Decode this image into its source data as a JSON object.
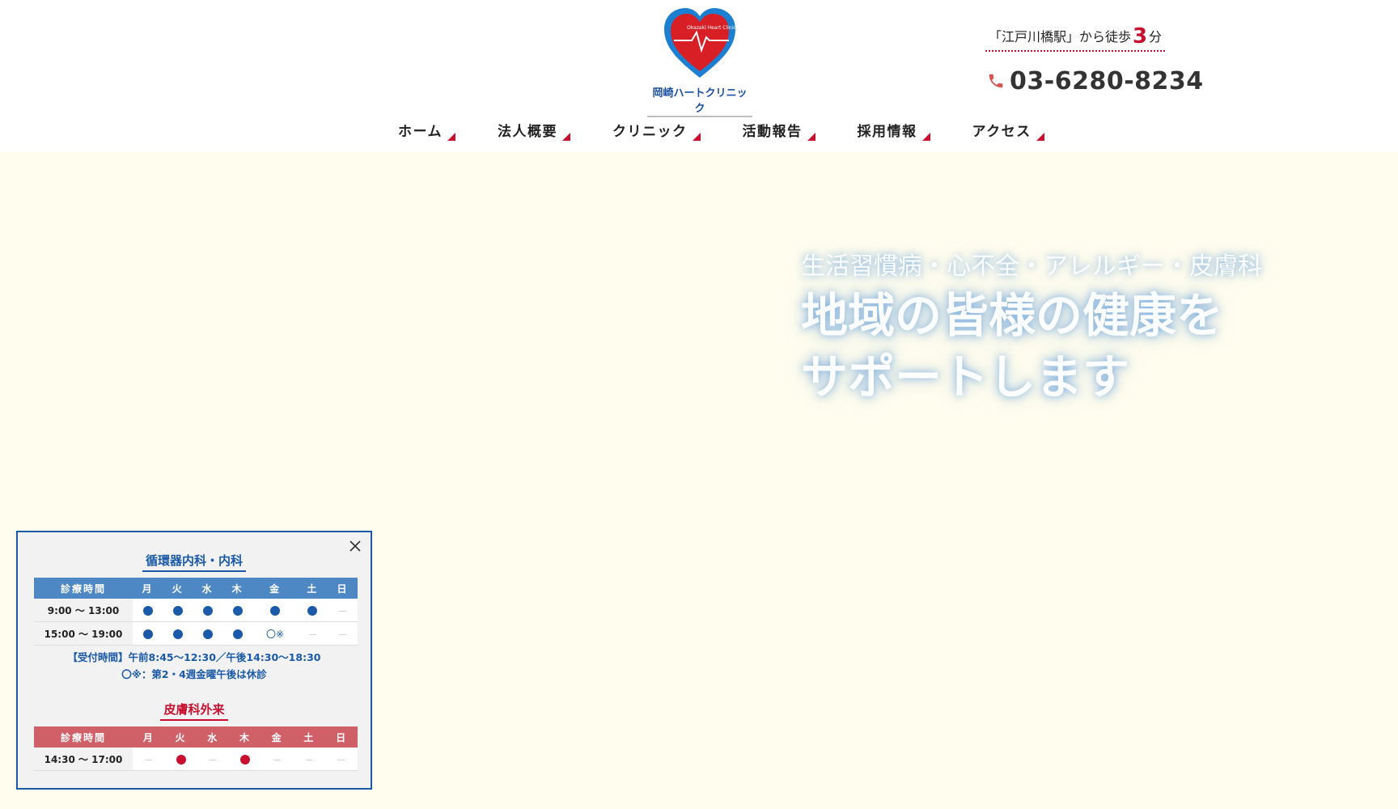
{
  "header": {
    "logo": {
      "text": "岡崎ハートクリニック",
      "emblem_text": "Okazaki Heart Clinic"
    },
    "access": {
      "prefix": "「江戸川橋駅」から徒歩",
      "minutes": "3",
      "suffix": "分"
    },
    "phone": "03-6280-8234"
  },
  "nav": [
    {
      "label": "ホーム"
    },
    {
      "label": "法人概要"
    },
    {
      "label": "クリニック"
    },
    {
      "label": "活動報告"
    },
    {
      "label": "採用情報"
    },
    {
      "label": "アクセス"
    }
  ],
  "hero": {
    "subtitle": "生活習慣病・心不全・アレルギー・皮膚科",
    "title_line1": "地域の皆様の健康を",
    "title_line2": "サポートします"
  },
  "schedule": {
    "internal": {
      "title": "循環器内科・内科",
      "headers": [
        "診療時間",
        "月",
        "火",
        "水",
        "木",
        "金",
        "土",
        "日"
      ],
      "rows": [
        {
          "time": "9:00 〜 13:00",
          "days": [
            "dot",
            "dot",
            "dot",
            "dot",
            "dot",
            "dot",
            "dash"
          ]
        },
        {
          "time": "15:00 〜 19:00",
          "days": [
            "dot",
            "dot",
            "dot",
            "dot",
            "ring",
            "dash",
            "dash"
          ]
        }
      ],
      "ring_label": "〇※",
      "dash_label": "—",
      "note1": "【受付時間】午前8:45〜12:30／午後14:30〜18:30",
      "note2": "〇※：第2・4週金曜午後は休診"
    },
    "derma": {
      "title": "皮膚科外来",
      "headers": [
        "診療時間",
        "月",
        "火",
        "水",
        "木",
        "金",
        "土",
        "日"
      ],
      "rows": [
        {
          "time": "14:30 〜 17:00",
          "days": [
            "dash",
            "dot",
            "dash",
            "dot",
            "dash",
            "dash",
            "dash"
          ]
        }
      ]
    }
  },
  "colors": {
    "accent_red": "#c8102e",
    "accent_blue": "#1a5aa8",
    "bg": "#fffdee"
  }
}
